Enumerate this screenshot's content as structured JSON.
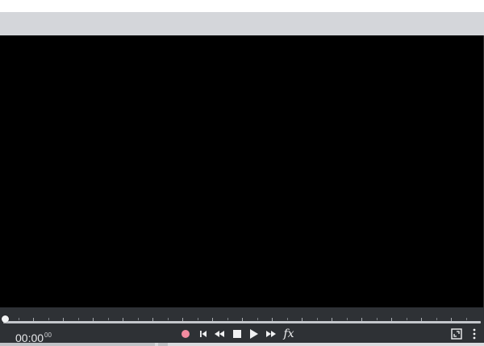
{
  "transport": {
    "time_main": "00:00",
    "time_frames": "00",
    "progress": 0
  },
  "icons": {
    "record": "record-icon",
    "skip_start": "skip-to-start-icon",
    "rewind": "rewind-icon",
    "stop": "stop-icon",
    "play": "play-icon",
    "fast_forward": "fast-forward-icon",
    "fx": "fx-icon",
    "fullscreen": "fullscreen-icon",
    "more": "more-vertical-icon"
  },
  "fx_label": "fx",
  "colors": {
    "record": "#f28ba0",
    "viewer_background": "#000000",
    "transport_background": "#2e3135",
    "title_bar": "#d4d6da"
  }
}
